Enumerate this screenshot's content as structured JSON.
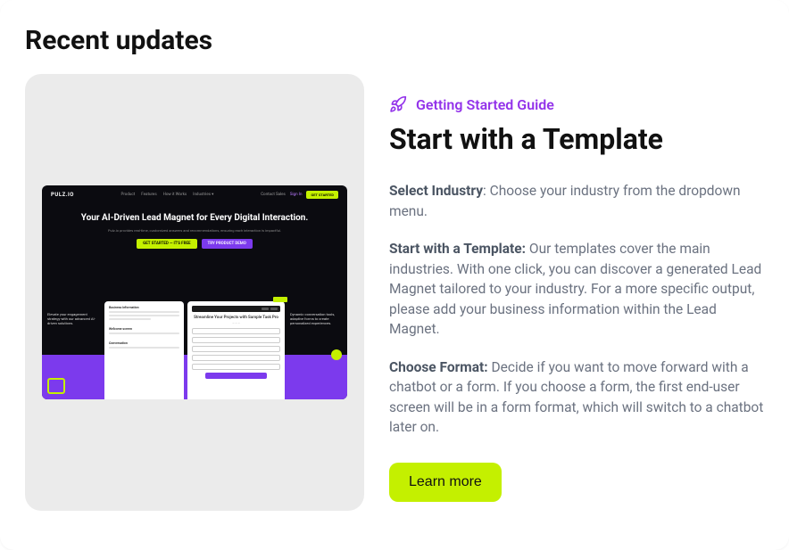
{
  "heading": "Recent updates",
  "category": "Getting Started Guide",
  "title": "Start with a Template",
  "paragraphs": [
    {
      "strong": "Select Industry",
      "sep": ": ",
      "rest": "Choose your industry from the dropdown menu."
    },
    {
      "strong": "Start with a Template:",
      "sep": " ",
      "rest": "Our templates cover the main industries. With one click, you can discover a generated Lead Magnet tailored to your industry. For a more specific output, please add your business information within the Lead Magnet."
    },
    {
      "strong": "Choose Format:",
      "sep": " ",
      "rest": "Decide if you want to move forward with a chatbot or a form. If you choose a form, the first end-user screen will be in a form format, which will switch to a chatbot later on."
    }
  ],
  "learn_more": "Learn more",
  "mock": {
    "brand": "PULZ.IO",
    "nav": [
      "Product",
      "Features",
      "How it Works",
      "Industries ▾"
    ],
    "contact": "Contact Sales",
    "signin": "Sign In",
    "getstarted": "GET STARTED",
    "hero_title": "Your AI-Driven Lead Magnet for Every Digital Interaction.",
    "hero_sub": "Pulz.io provides real-time, customized answers and recommendations, ensuring each interaction is impactful.",
    "cta1": "GET STARTED — IT'S FREE",
    "cta2": "TRY PRODUCT DEMO",
    "side_left": "Elevate your engagement strategy with our advanced AI-driven solutions.",
    "side_right": "Dynamic conversation tools, adaptive forms to create personalized experiences.",
    "form_title": "Streamline Your Projects with Sample Task Pro",
    "left_label1": "Business Information",
    "left_label2": "Welcome screen",
    "left_label3": "Conversation"
  }
}
